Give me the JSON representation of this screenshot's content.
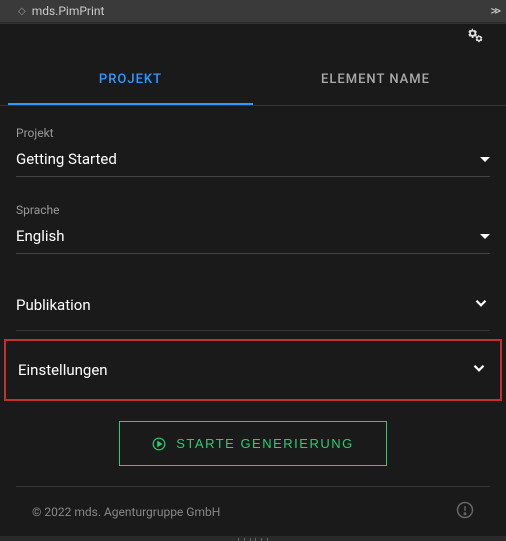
{
  "titlebar": {
    "title": "mds.PimPrint"
  },
  "tabs": {
    "projekt": "PROJEKT",
    "element_name": "ELEMENT NAME"
  },
  "form": {
    "projekt": {
      "label": "Projekt",
      "value": "Getting Started"
    },
    "sprache": {
      "label": "Sprache",
      "value": "English"
    }
  },
  "accordions": {
    "publikation": "Publikation",
    "einstellungen": "Einstellungen"
  },
  "button": {
    "generate": "STARTE GENERIERUNG"
  },
  "footer": {
    "copyright": "© 2022 mds. Agenturgruppe GmbH"
  }
}
